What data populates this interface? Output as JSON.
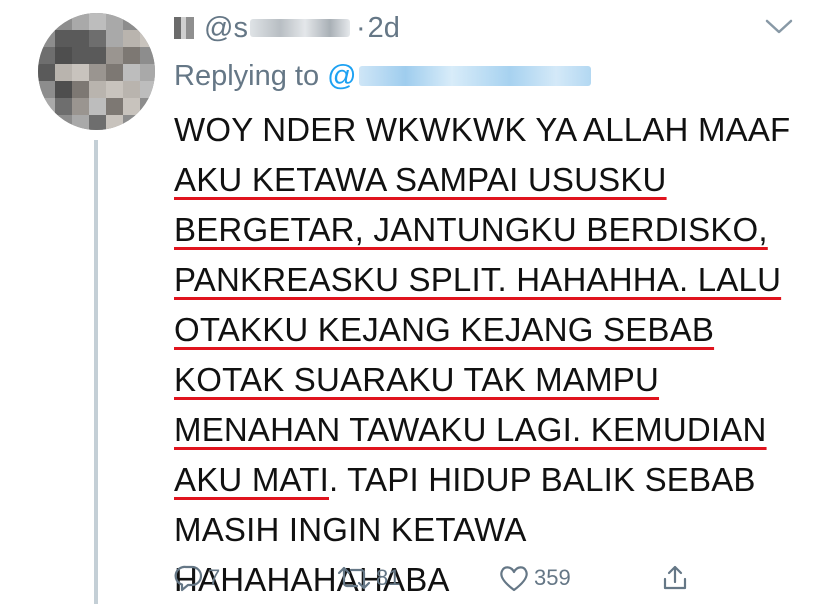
{
  "tweet": {
    "author_name": "h",
    "handle_prefix": "@s",
    "time_separator": "·",
    "time": "2d",
    "replying_label": "Replying to",
    "replying_mention_prefix": "@",
    "text_lines": [
      {
        "pre": "",
        "underlined": "",
        "post": "WOY NDER WKWKWK YA ALLAH MAAF"
      },
      {
        "pre": "",
        "underlined": "AKU KETAWA SAMPAI USUSKU",
        "post": ""
      },
      {
        "pre": "",
        "underlined": "BERGETAR, JANTUNGKU BERDISKO,",
        "post": ""
      },
      {
        "pre": "",
        "underlined": "PANKREASKU SPLIT. HAHAHHA. LALU",
        "post": ""
      },
      {
        "pre": "",
        "underlined": "OTAKKU KEJANG KEJANG SEBAB",
        "post": ""
      },
      {
        "pre": "",
        "underlined": "KOTAK SUARAKU TAK MAMPU",
        "post": ""
      },
      {
        "pre": "",
        "underlined": "MENAHAN TAWAKU LAGI. KEMUDIAN",
        "post": ""
      },
      {
        "pre": "",
        "underlined": "AKU MATI",
        "post": ". TAPI HIDUP BALIK SEBAB"
      },
      {
        "pre": "",
        "underlined": "",
        "post": "MASIH INGIN KETAWA"
      },
      {
        "pre": "",
        "underlined": "",
        "post": "HAHAHAHAHABA"
      }
    ],
    "actions": {
      "reply_count": "7",
      "retweet_count": "81",
      "like_count": "359"
    }
  },
  "icons": {
    "reply": "reply-icon",
    "retweet": "retweet-icon",
    "like": "heart-icon",
    "share": "share-icon",
    "menu": "chevron-down-icon"
  },
  "colors": {
    "muted": "#657786",
    "link": "#1da1f2",
    "underline": "#e0141e",
    "thread_line": "#c4cfd6"
  }
}
